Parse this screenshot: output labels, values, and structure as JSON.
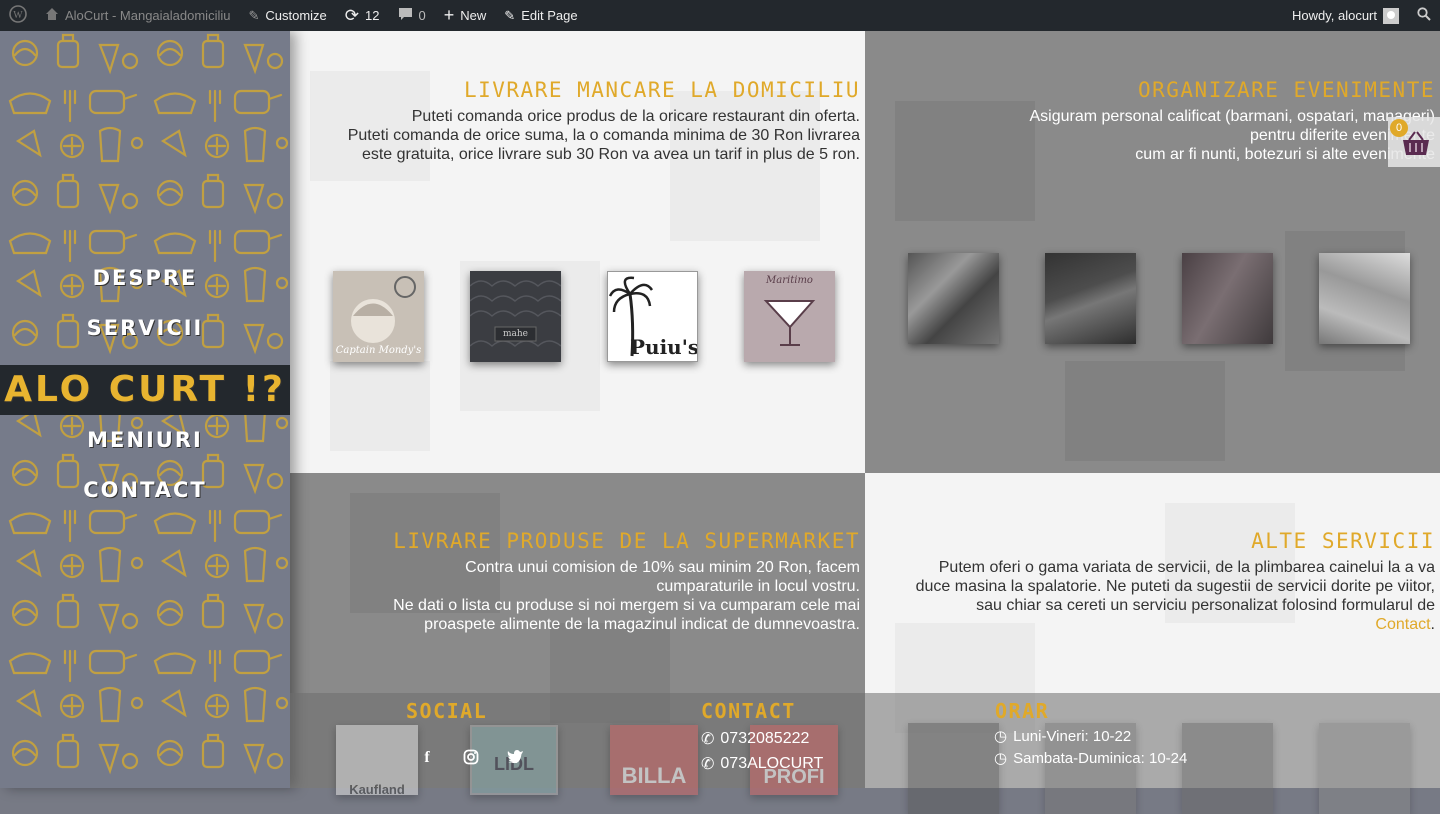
{
  "adminbar": {
    "site_name": "AloCurt - Mangaialadomiciliu",
    "customize": "Customize",
    "updates_count": "12",
    "comments_count": "0",
    "new_label": "New",
    "edit_page": "Edit Page",
    "howdy": "Howdy, alocurt"
  },
  "nav": {
    "items": [
      "DESPRE",
      "SERVICII",
      "ALO CURT !?",
      "MENIURI",
      "CONTACT"
    ]
  },
  "panels": {
    "delivery": {
      "title": "LIVRARE MANCARE LA DOMICILIU",
      "text1": "Puteti comanda orice produs de la oricare restaurant din oferta.",
      "text2": "Puteti comanda de orice suma, la o comanda minima de 30 Ron livrarea este gratuita, orice livrare sub 30 Ron va avea un tarif in plus de 5 ron.",
      "thumbs": [
        "Captain Mondy's",
        "mahe",
        "Puiu's",
        "Maritimo"
      ]
    },
    "events": {
      "title": "ORGANIZARE EVENIMENTE",
      "text1": "Asiguram personal calificat (barmani, ospatari, manageri)",
      "text2": "pentru diferite evenimente",
      "text3": "cum ar fi nunti, botezuri si alte evenimente"
    },
    "supermarket": {
      "title": "LIVRARE PRODUSE DE LA SUPERMARKET",
      "text1": "Contra unui comision de 10% sau minim 20 Ron, facem cumparaturile in locul vostru.",
      "text2": "Ne dati o lista cu produse si noi mergem si va cumparam cele mai proaspete alimente de la magazinul indicat de dumnevoastra."
    },
    "other": {
      "title": "ALTE SERVICII",
      "text": "Putem oferi o gama variata de servicii, de la plimbarea cainelui la a va duce masina la spalatorie. Ne puteti da sugestii de servicii dorite pe viitor, sau chiar sa cereti un serviciu personalizat folosind formularul de",
      "link": "Contact",
      "period": "."
    }
  },
  "footer": {
    "social_title": "SOCIAL",
    "contact_title": "CONTACT",
    "phone1": "0732085222",
    "phone2": "073ALOCURT",
    "orar_title": "ORAR",
    "hours1": "Luni-Vineri: 10-22",
    "hours2": "Sambata-Duminica: 10-24",
    "store_logos": [
      "Kaufland",
      "LIDL",
      "BILLA",
      "PROFI"
    ]
  },
  "cart": {
    "count": "0"
  },
  "colors": {
    "accent": "#e0a92a",
    "dark": "#23282d",
    "sidebar": "#767b8a"
  }
}
